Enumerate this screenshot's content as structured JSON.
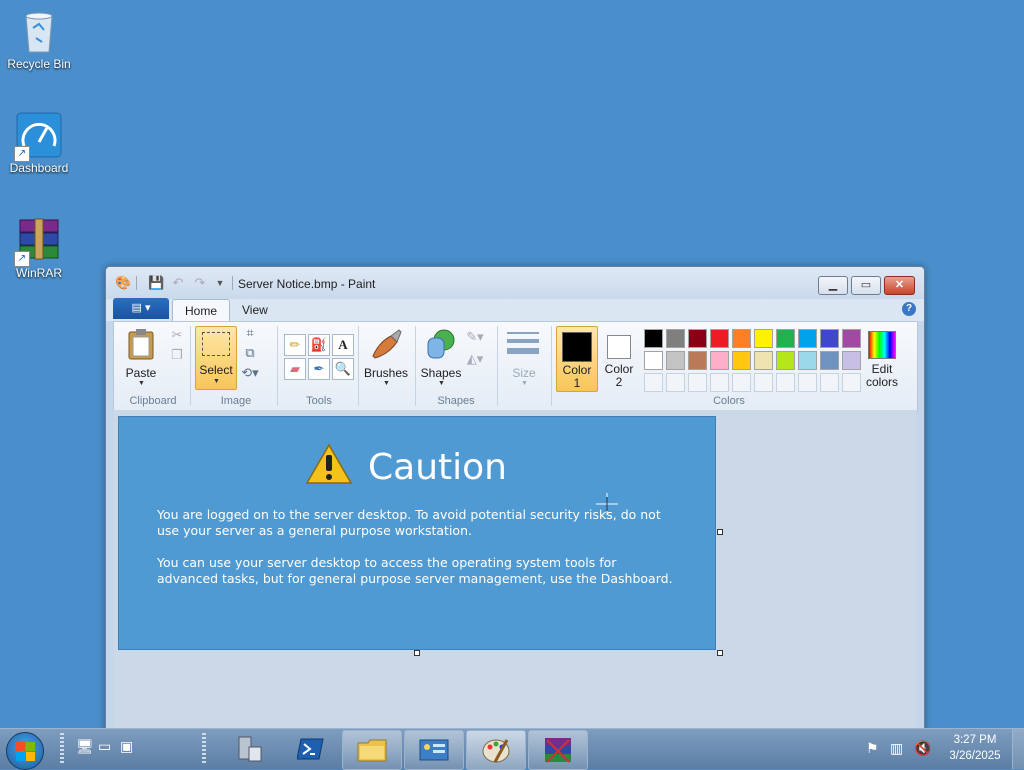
{
  "desktop": {
    "icons": [
      {
        "label": "Recycle Bin"
      },
      {
        "label": "Dashboard"
      },
      {
        "label": "WinRAR"
      }
    ]
  },
  "window": {
    "title": "Server Notice.bmp - Paint",
    "tabs": {
      "home": "Home",
      "view": "View"
    }
  },
  "ribbon": {
    "clipboard": {
      "paste": "Paste",
      "group": "Clipboard"
    },
    "image": {
      "select": "Select",
      "group": "Image"
    },
    "tools": {
      "group": "Tools"
    },
    "brushes": {
      "label": "Brushes"
    },
    "shapes": {
      "label": "Shapes",
      "group": "Shapes"
    },
    "size": {
      "label": "Size"
    },
    "colors": {
      "color1_line1": "Color",
      "color1_line2": "1",
      "color2_line1": "Color",
      "color2_line2": "2",
      "edit_line1": "Edit",
      "edit_line2": "colors",
      "group": "Colors",
      "color1_value": "#000000",
      "color2_value": "#ffffff",
      "palette_row1": [
        "#000000",
        "#7f7f7f",
        "#880015",
        "#ed1c24",
        "#ff7f27",
        "#fff200",
        "#22b14c",
        "#00a2e8",
        "#3f48cc",
        "#a349a4"
      ],
      "palette_row2": [
        "#ffffff",
        "#c3c3c3",
        "#b97a57",
        "#ffaec9",
        "#ffc90e",
        "#efe4b0",
        "#b5e61d",
        "#99d9ea",
        "#7092be",
        "#c8bfe7"
      ]
    }
  },
  "canvas": {
    "heading": "Caution",
    "paragraph1": "You are logged on to the server desktop. To avoid potential security risks, do not use your server as a general purpose workstation.",
    "paragraph2": "You can use your server desktop to access the operating system tools for advanced tasks, but for general purpose server management, use the Dashboard."
  },
  "taskbar": {
    "time": "3:27 PM",
    "date": "3/26/2025"
  }
}
